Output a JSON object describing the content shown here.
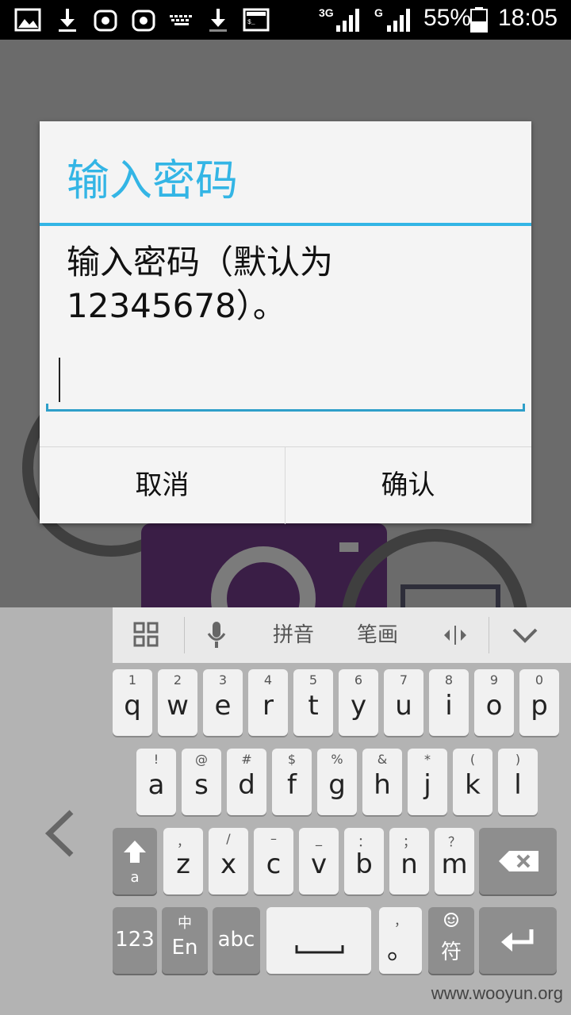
{
  "status_bar": {
    "net1_label": "3G",
    "net2_label": "G",
    "battery": "55%",
    "time": "18:05",
    "icons": [
      "image-icon",
      "download-icon",
      "android-app-icon",
      "android-app-icon",
      "keyboard-icon",
      "download-icon",
      "terminal-icon"
    ]
  },
  "dialog": {
    "title": "输入密码",
    "message": "输入密码（默认为12345678）。",
    "password_value": "",
    "cancel_label": "取消",
    "confirm_label": "确认"
  },
  "keyboard": {
    "toolbar": {
      "pinyin_label": "拼音",
      "stroke_label": "笔画"
    },
    "row1": [
      {
        "hint": "1",
        "ch": "q"
      },
      {
        "hint": "2",
        "ch": "w"
      },
      {
        "hint": "3",
        "ch": "e"
      },
      {
        "hint": "4",
        "ch": "r"
      },
      {
        "hint": "5",
        "ch": "t"
      },
      {
        "hint": "6",
        "ch": "y"
      },
      {
        "hint": "7",
        "ch": "u"
      },
      {
        "hint": "8",
        "ch": "i"
      },
      {
        "hint": "9",
        "ch": "o"
      },
      {
        "hint": "0",
        "ch": "p"
      }
    ],
    "row2": [
      {
        "hint": "!",
        "ch": "a"
      },
      {
        "hint": "@",
        "ch": "s"
      },
      {
        "hint": "#",
        "ch": "d"
      },
      {
        "hint": "$",
        "ch": "f"
      },
      {
        "hint": "%",
        "ch": "g"
      },
      {
        "hint": "&",
        "ch": "h"
      },
      {
        "hint": "*",
        "ch": "j"
      },
      {
        "hint": "(",
        "ch": "k"
      },
      {
        "hint": ")",
        "ch": "l"
      }
    ],
    "row3": [
      {
        "hint": "，",
        "ch": "z"
      },
      {
        "hint": "/",
        "ch": "x"
      },
      {
        "hint": "–",
        "ch": "c"
      },
      {
        "hint": "_",
        "ch": "v"
      },
      {
        "hint": "：",
        "ch": "b"
      },
      {
        "hint": "；",
        "ch": "n"
      },
      {
        "hint": "？",
        "ch": "m"
      }
    ],
    "shift_sub": "a",
    "num_label": "123",
    "lang_hint": "中",
    "lang_label": "En",
    "abc_label": "abc",
    "punct_hint": "，",
    "punct_label": "。",
    "symbol_label": "符"
  },
  "watermark": "www.wooyun.org"
}
